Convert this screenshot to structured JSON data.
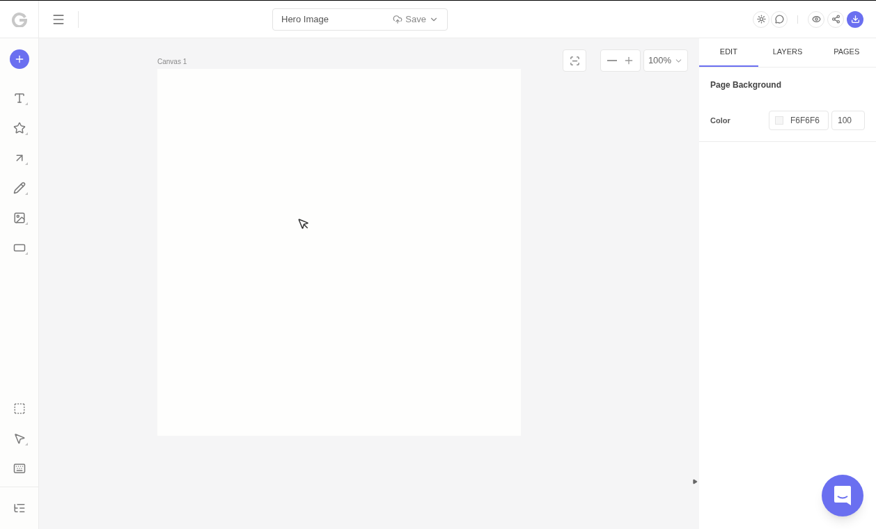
{
  "header": {
    "document_title": "Hero Image",
    "save_label": "Save"
  },
  "canvas": {
    "label": "Canvas 1"
  },
  "zoom": {
    "value": "100%"
  },
  "tabs": [
    {
      "label": "EDIT",
      "selected": true
    },
    {
      "label": "LAYERS",
      "selected": false
    },
    {
      "label": "PAGES",
      "selected": false
    }
  ],
  "panel": {
    "section_title": "Page Background",
    "color_label": "Color",
    "color_hex": "F6F6F6",
    "opacity": "100"
  }
}
